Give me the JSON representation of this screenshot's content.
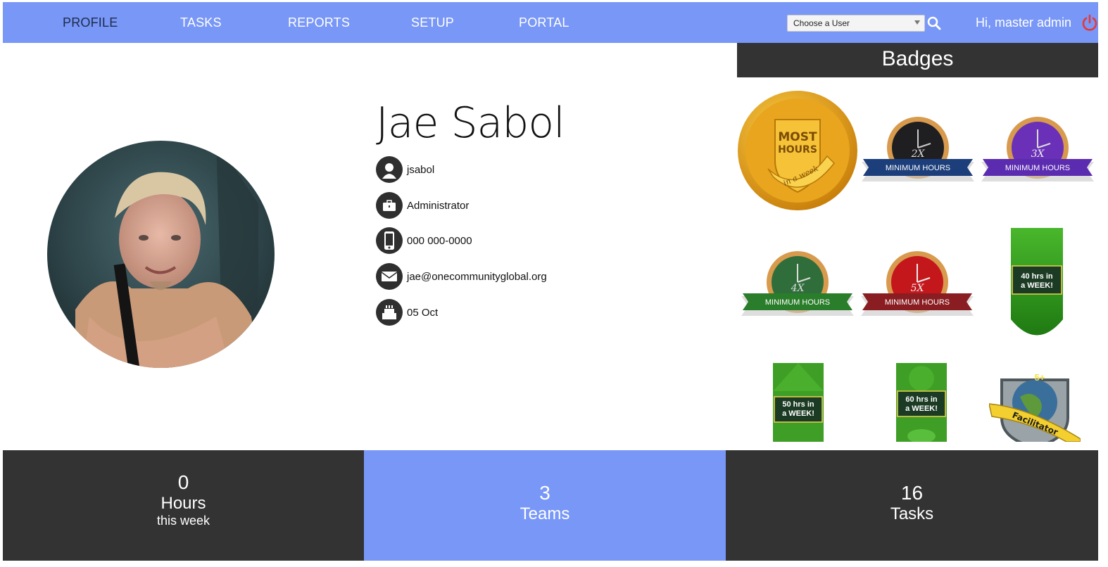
{
  "nav": {
    "items": [
      {
        "label": "PROFILE",
        "active": true
      },
      {
        "label": "TASKS",
        "active": false
      },
      {
        "label": "REPORTS",
        "active": false
      },
      {
        "label": "SETUP",
        "active": false
      },
      {
        "label": "PORTAL",
        "active": false
      }
    ],
    "user_select_value": "Choose a User",
    "greeting": "Hi, master admin"
  },
  "profile": {
    "name": "Jae Sabol",
    "username": "jsabol",
    "role": "Administrator",
    "phone": "000 000-0000",
    "email": "jae@onecommunityglobal.org",
    "birthday": "05 Oct",
    "icons": [
      "user-icon",
      "briefcase-icon",
      "phone-icon",
      "email-icon",
      "birthday-cake-icon"
    ]
  },
  "badges": {
    "title": "Badges",
    "items": [
      {
        "icon": "most-hours-badge",
        "lines": [
          "MOST",
          "HOURS"
        ],
        "ribbon": "in a week"
      },
      {
        "icon": "clock-2x-badge",
        "multiplier": "2X",
        "ribbon": "MINIMUM HOURS",
        "color": "#1c3e7a"
      },
      {
        "icon": "clock-3x-badge",
        "multiplier": "3X",
        "ribbon": "MINIMUM HOURS",
        "color": "#5b2bb0"
      },
      {
        "icon": "clock-4x-badge",
        "multiplier": "4X",
        "ribbon": "MINIMUM HOURS",
        "color": "#2a7d2a"
      },
      {
        "icon": "clock-5x-badge",
        "multiplier": "5X",
        "ribbon": "MINIMUM HOURS",
        "color": "#8a1d22"
      },
      {
        "icon": "banner-40-badge",
        "lines": [
          "40 hrs in",
          "a WEEK!"
        ]
      },
      {
        "icon": "banner-50-badge",
        "lines": [
          "50 hrs in",
          "a WEEK!"
        ]
      },
      {
        "icon": "banner-60-badge",
        "lines": [
          "60 hrs in",
          "a WEEK!"
        ]
      },
      {
        "icon": "facilitator-badge",
        "count": "5+",
        "ribbon": "Facilitator"
      }
    ]
  },
  "stats": {
    "hours": {
      "value": "0",
      "label": "Hours",
      "sub": "this week"
    },
    "teams": {
      "value": "3",
      "label": "Teams"
    },
    "tasks": {
      "value": "16",
      "label": "Tasks"
    }
  },
  "colors": {
    "nav": "#7897f7",
    "dark": "#333333",
    "accent_red": "#e53935"
  }
}
